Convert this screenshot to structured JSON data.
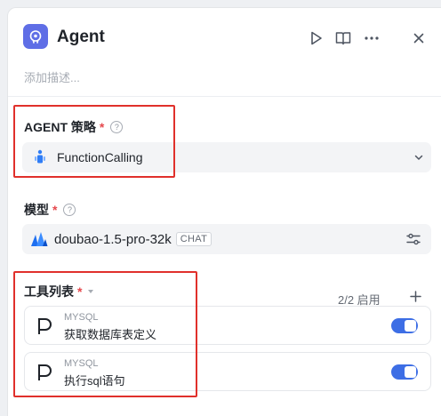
{
  "header": {
    "title": "Agent",
    "description_placeholder": "添加描述...",
    "icons": [
      "play-icon",
      "book-icon",
      "more-icon",
      "close-icon"
    ],
    "logo_color": "#5f6ee6"
  },
  "strategy": {
    "label": "AGENT 策略",
    "required_mark": "*",
    "help": "?",
    "selected": "FunctionCalling"
  },
  "model": {
    "label": "模型",
    "required_mark": "*",
    "help": "?",
    "name": "doubao-1.5-pro-32k",
    "badge": "CHAT"
  },
  "tools": {
    "label": "工具列表",
    "required_mark": "*",
    "count_text": "2/2 启用",
    "items": [
      {
        "provider": "MYSQL",
        "name": "获取数据库表定义",
        "enabled": true
      },
      {
        "provider": "MYSQL",
        "name": "执行sql语句",
        "enabled": true
      }
    ]
  },
  "colors": {
    "accent": "#3d6ee5",
    "required": "#e5484d",
    "highlight": "#e0302b"
  }
}
